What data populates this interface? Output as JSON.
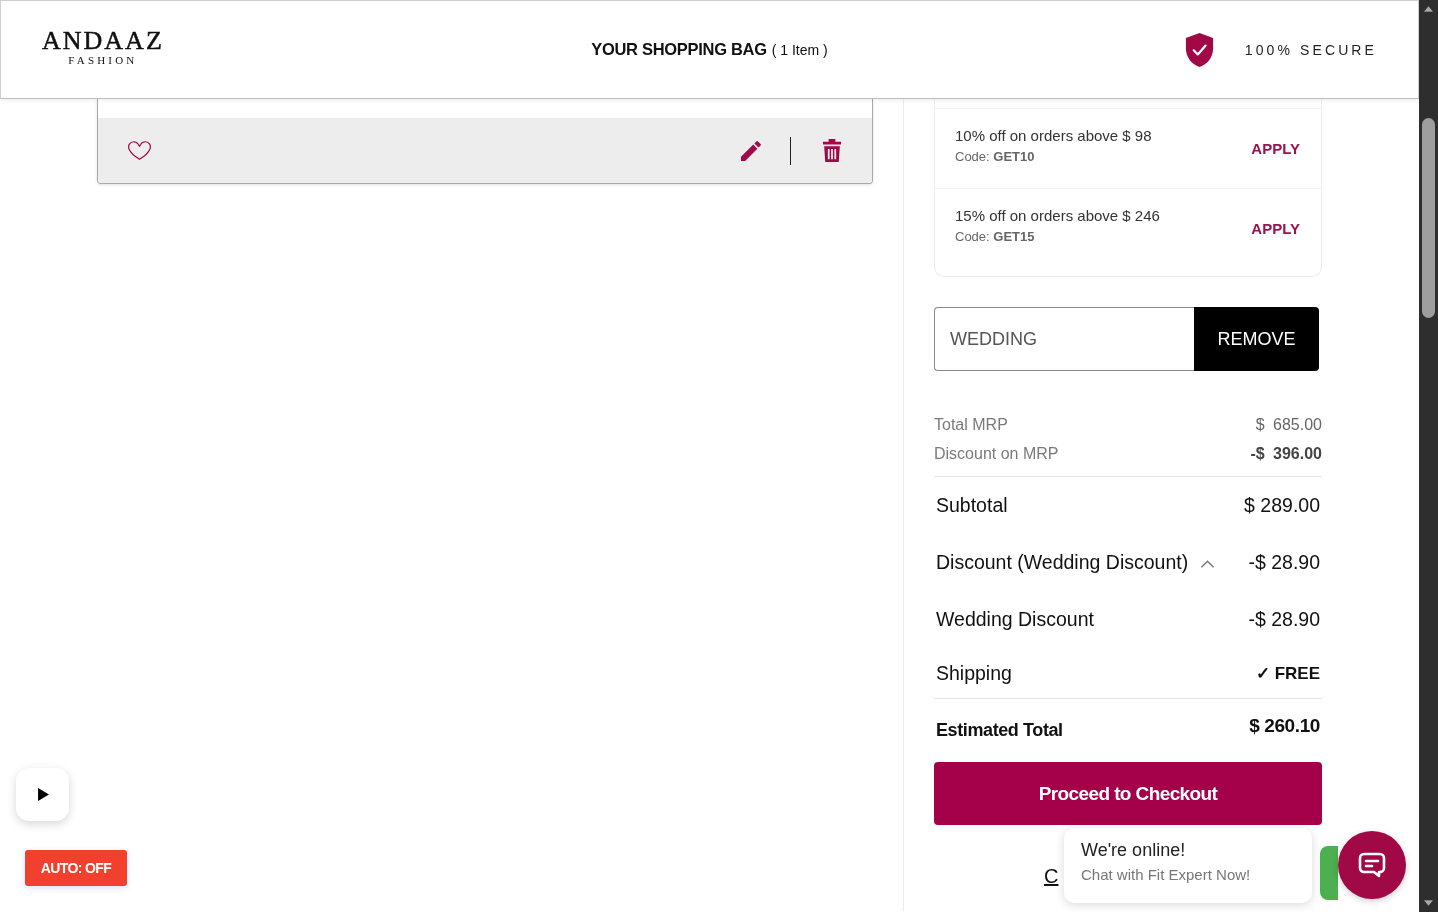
{
  "header": {
    "logo_name": "ANDAAZ",
    "logo_tagline": "FASHION",
    "title": "YOUR SHOPPING BAG",
    "item_count": "( 1 Item )",
    "secure_label": "100% SECURE"
  },
  "cart_item": {
    "wishlisted": false
  },
  "offers": [
    {
      "description": "10% off on orders above $ 98",
      "code": "Code: **GET10**",
      "action": "APPLY"
    },
    {
      "description": "15% off on orders above $ 246",
      "code": "Code: **GET15**",
      "action": "APPLY"
    }
  ],
  "coupon": {
    "value": "WEDDING",
    "button": "REMOVE"
  },
  "price_breakdown": [
    {
      "label": "Total MRP",
      "value": "$ 685.00",
      "kind": "charge"
    },
    {
      "label": "Discount on MRP",
      "value": "-$ 396.00",
      "kind": "deduction"
    }
  ],
  "summary": {
    "subtotal": {
      "label": "Subtotal",
      "value": "$ 289.00"
    },
    "discount": {
      "label": "Discount (Wedding Discount)",
      "value": "-$ 28.90",
      "expanded": true,
      "children": [
        {
          "label": "Wedding Discount",
          "value": "-$ 28.90"
        }
      ]
    },
    "shipping": {
      "label": "Shipping",
      "value": "✓ FREE"
    },
    "total": {
      "label": "Estimated Total",
      "value": "$ 260.10"
    }
  },
  "checkout_button": "Proceed to Checkout",
  "continue_link": "C",
  "media_player": {
    "autoplay_label": "AUTO: OFF"
  },
  "chat_prompt": {
    "title": "We're online!",
    "subtitle": "Chat with Fit Expert Now!"
  }
}
